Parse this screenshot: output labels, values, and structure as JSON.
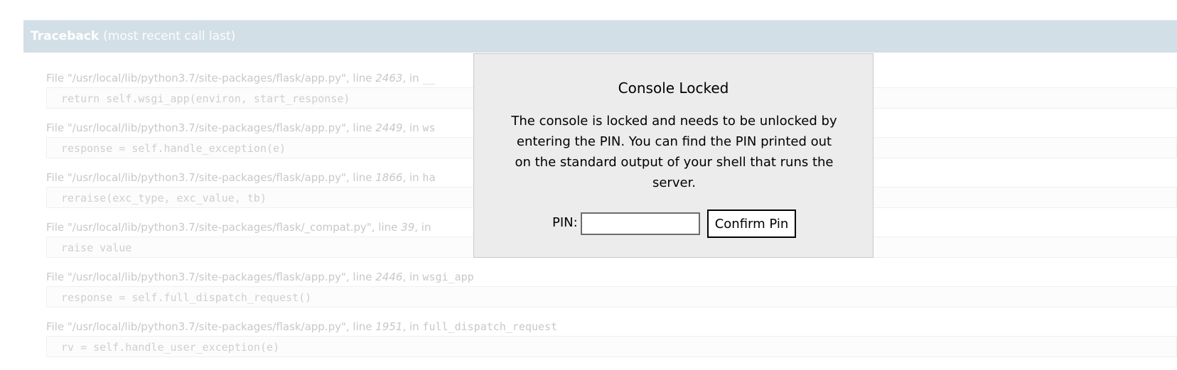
{
  "header": {
    "title": "Traceback",
    "subtitle": "(most recent call last)"
  },
  "frames": [
    {
      "prefix": "File \"",
      "path": "/usr/local/lib/python3.7/site-packages/flask/app.py",
      "mid": "\", line ",
      "line": "2463",
      "in": ", in ",
      "fn": "__",
      "code": "return self.wsgi_app(environ, start_response)"
    },
    {
      "prefix": "File \"",
      "path": "/usr/local/lib/python3.7/site-packages/flask/app.py",
      "mid": "\", line ",
      "line": "2449",
      "in": ", in ",
      "fn": "ws",
      "code": "response = self.handle_exception(e)"
    },
    {
      "prefix": "File \"",
      "path": "/usr/local/lib/python3.7/site-packages/flask/app.py",
      "mid": "\", line ",
      "line": "1866",
      "in": ", in ",
      "fn": "ha",
      "code": "reraise(exc_type, exc_value, tb)"
    },
    {
      "prefix": "File \"",
      "path": "/usr/local/lib/python3.7/site-packages/flask/_compat.py",
      "mid": "\", line ",
      "line": "39",
      "in": ", in ",
      "fn": "",
      "code": "raise value"
    },
    {
      "prefix": "File \"",
      "path": "/usr/local/lib/python3.7/site-packages/flask/app.py",
      "mid": "\", line ",
      "line": "2446",
      "in": ", in ",
      "fn": "wsgi_app",
      "code": "response = self.full_dispatch_request()"
    },
    {
      "prefix": "File \"",
      "path": "/usr/local/lib/python3.7/site-packages/flask/app.py",
      "mid": "\", line ",
      "line": "1951",
      "in": ", in ",
      "fn": "full_dispatch_request",
      "code": "rv = self.handle_user_exception(e)"
    }
  ],
  "modal": {
    "title": "Console Locked",
    "body": "The console is locked and needs to be unlocked by entering the PIN. You can find the PIN printed out on the standard output of your shell that runs the server.",
    "pin_label": "PIN:",
    "pin_value": "",
    "confirm_label": "Confirm Pin"
  },
  "colors": {
    "header_bg": "#d3dfe6",
    "modal_bg": "#ececec",
    "faded_text": "#c8c8c8"
  }
}
